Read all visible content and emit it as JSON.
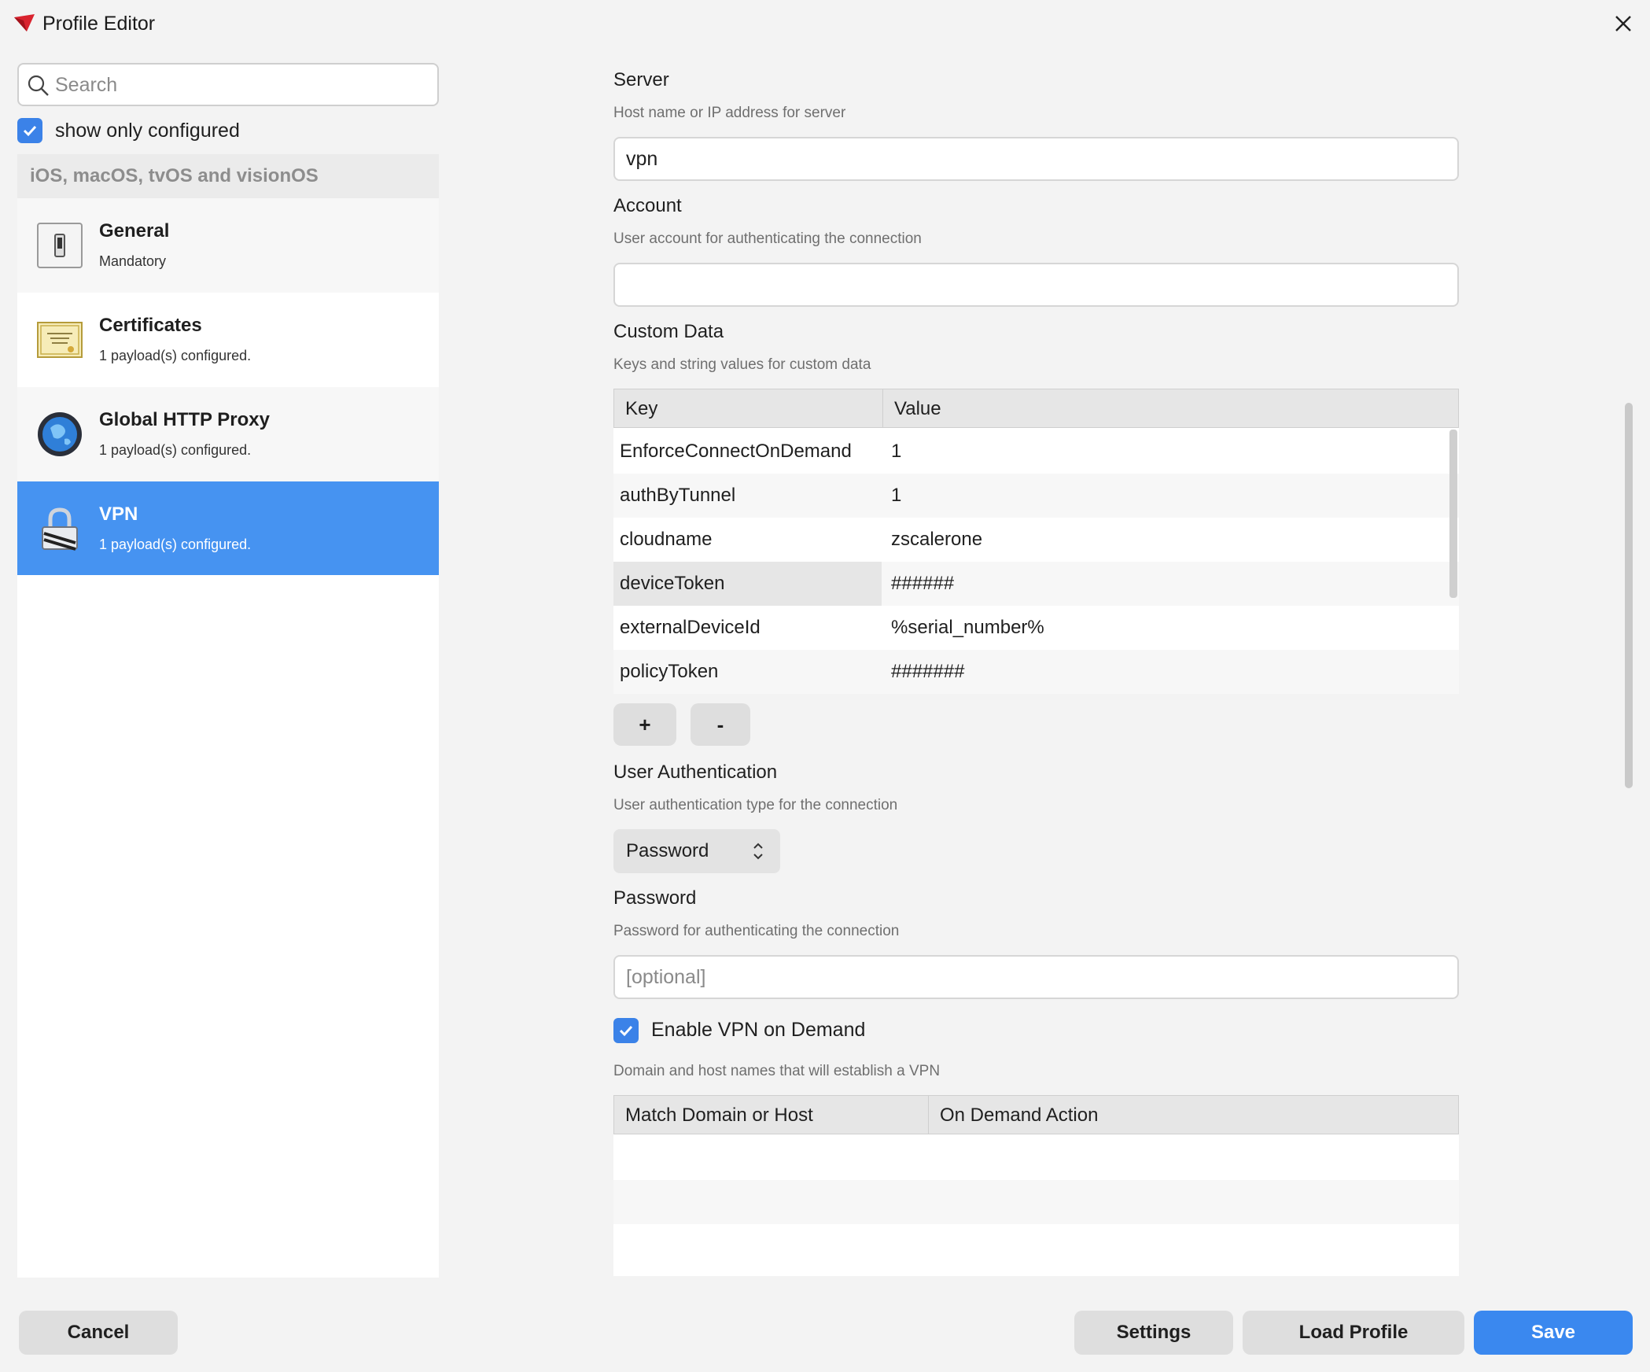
{
  "window": {
    "title": "Profile Editor"
  },
  "sidebar": {
    "search_placeholder": "Search",
    "filter_label": "show only configured",
    "filter_checked": true,
    "section_header": "iOS, macOS, tvOS and visionOS",
    "items": [
      {
        "title": "General",
        "subtitle": "Mandatory",
        "icon": "switch-icon",
        "selected": false
      },
      {
        "title": "Certificates",
        "subtitle": "1 payload(s) configured.",
        "icon": "certificate-icon",
        "selected": false
      },
      {
        "title": "Global HTTP Proxy",
        "subtitle": "1 payload(s) configured.",
        "icon": "globe-icon",
        "selected": false
      },
      {
        "title": "VPN",
        "subtitle": "1 payload(s) configured.",
        "icon": "lock-icon",
        "selected": true
      }
    ]
  },
  "form": {
    "server": {
      "label": "Server",
      "description": "Host name or IP address for server",
      "value": "vpn"
    },
    "account": {
      "label": "Account",
      "description": "User account for authenticating the connection",
      "value": ""
    },
    "custom_data": {
      "label": "Custom Data",
      "description": "Keys and string values for custom data",
      "columns": [
        "Key",
        "Value"
      ],
      "rows": [
        {
          "key": "EnforceConnectOnDemand",
          "value": "1"
        },
        {
          "key": "authByTunnel",
          "value": "1"
        },
        {
          "key": "cloudname",
          "value": "zscalerone"
        },
        {
          "key": "deviceToken",
          "value": "######"
        },
        {
          "key": "externalDeviceId",
          "value": "%serial_number%"
        },
        {
          "key": "policyToken",
          "value": "#######"
        }
      ],
      "add_label": "+",
      "remove_label": "-"
    },
    "user_auth": {
      "label": "User Authentication",
      "description": "User authentication type for the connection",
      "selected": "Password"
    },
    "password": {
      "label": "Password",
      "description": "Password for authenticating the connection",
      "placeholder": "[optional]"
    },
    "vpn_on_demand": {
      "label": "Enable VPN on Demand",
      "checked": true,
      "description": "Domain and host names that will establish a VPN",
      "columns": [
        "Match Domain or Host",
        "On Demand Action"
      ]
    }
  },
  "footer": {
    "cancel_label": "Cancel",
    "settings_label": "Settings",
    "load_label": "Load Profile",
    "save_label": "Save"
  },
  "colors": {
    "accent": "#3a88ef",
    "selected_item": "#4693f1"
  }
}
